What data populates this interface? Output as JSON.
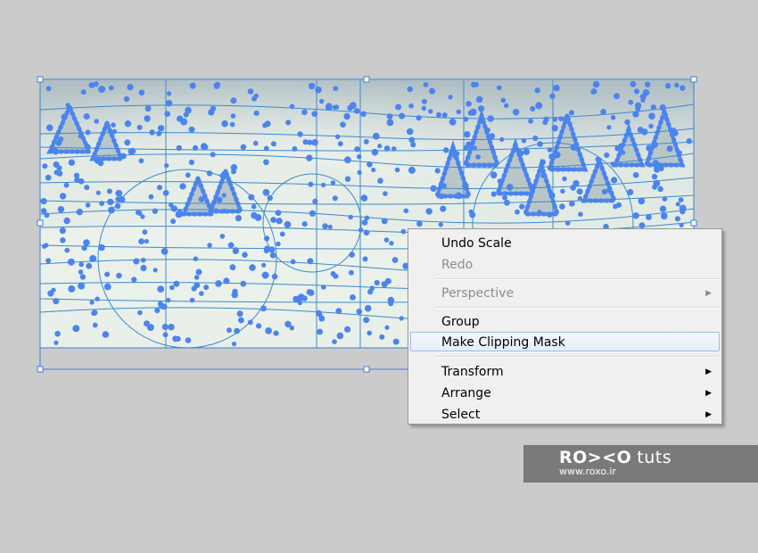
{
  "context_menu": {
    "items": [
      {
        "label": "Undo Scale",
        "enabled": true,
        "submenu": false,
        "highlighted": false
      },
      {
        "label": "Redo",
        "enabled": false,
        "submenu": false,
        "highlighted": false
      },
      {
        "label": "Perspective",
        "enabled": false,
        "submenu": true,
        "highlighted": false
      },
      {
        "label": "Group",
        "enabled": true,
        "submenu": false,
        "highlighted": false
      },
      {
        "label": "Make Clipping Mask",
        "enabled": true,
        "submenu": false,
        "highlighted": true
      },
      {
        "label": "Transform",
        "enabled": true,
        "submenu": true,
        "highlighted": false
      },
      {
        "label": "Arrange",
        "enabled": true,
        "submenu": true,
        "highlighted": false
      },
      {
        "label": "Select",
        "enabled": true,
        "submenu": true,
        "highlighted": false
      }
    ]
  },
  "watermark": {
    "brand": "RO><O",
    "suffix": "tuts",
    "url": "www.roxo.ir"
  },
  "colors": {
    "selection": "#4a86e8",
    "guide": "#2a7fc4",
    "highlight_border": "#9fbfe6"
  }
}
